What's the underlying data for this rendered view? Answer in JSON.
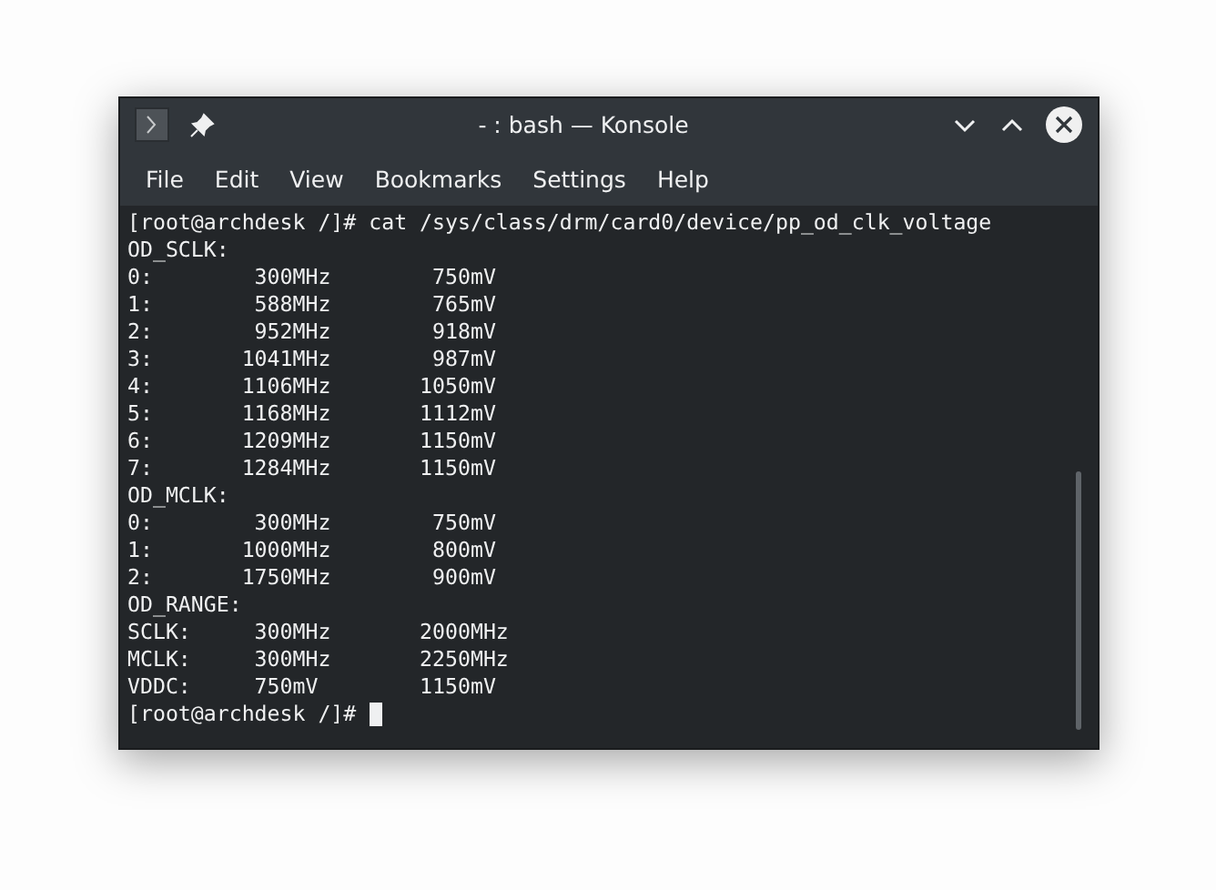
{
  "window": {
    "title": "- : bash — Konsole"
  },
  "menu": [
    "File",
    "Edit",
    "View",
    "Bookmarks",
    "Settings",
    "Help"
  ],
  "terminal": {
    "lines": [
      "[root@archdesk /]# cat /sys/class/drm/card0/device/pp_od_clk_voltage",
      "OD_SCLK:",
      "0:        300MHz        750mV",
      "1:        588MHz        765mV",
      "2:        952MHz        918mV",
      "3:       1041MHz        987mV",
      "4:       1106MHz       1050mV",
      "5:       1168MHz       1112mV",
      "6:       1209MHz       1150mV",
      "7:       1284MHz       1150mV",
      "OD_MCLK:",
      "0:        300MHz        750mV",
      "1:       1000MHz        800mV",
      "2:       1750MHz        900mV",
      "OD_RANGE:",
      "SCLK:     300MHz       2000MHz",
      "MCLK:     300MHz       2250MHz",
      "VDDC:     750mV        1150mV"
    ],
    "prompt": "[root@archdesk /]#"
  }
}
